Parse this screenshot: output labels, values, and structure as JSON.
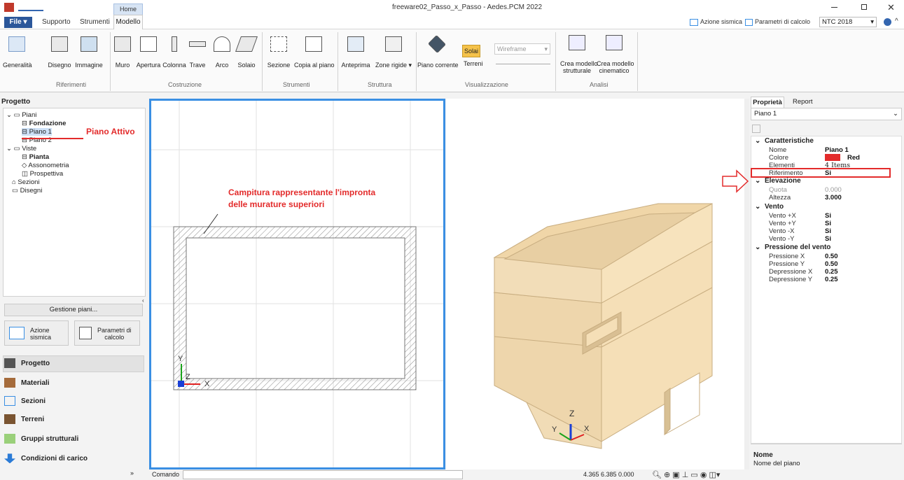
{
  "window": {
    "title": "freeware02_Passo_x_Passo - Aedes.PCM 2022",
    "quick_tab": "Home"
  },
  "tabs": {
    "file": "File",
    "supporto": "Supporto",
    "strumenti": "Strumenti",
    "modello": "Modello"
  },
  "topright": {
    "azione_sismica": "Azione sismica",
    "parametri": "Parametri di calcolo",
    "norm": "NTC 2018"
  },
  "ribbon": {
    "generalita": "Generalità",
    "disegno": "Disegno",
    "immagine": "Immagine",
    "riferimenti": "Riferimenti",
    "muro": "Muro",
    "apertura": "Apertura",
    "colonna": "Colonna",
    "trave": "Trave",
    "arco": "Arco",
    "solaio": "Solaio",
    "costruzione": "Costruzione",
    "sezione": "Sezione",
    "copia": "Copia al piano",
    "strumenti": "Strumenti",
    "anteprima": "Anteprima",
    "zone": "Zone rigide",
    "struttura": "Struttura",
    "piano_corrente": "Piano corrente",
    "solai": "Solai",
    "terreni": "Terreni",
    "wireframe": "Wireframe",
    "visualizzazione": "Visualizzazione",
    "crea_strutt_1": "Crea modello",
    "crea_strutt_2": "strutturale",
    "crea_cin_1": "Crea modello",
    "crea_cin_2": "cinematico",
    "analisi": "Analisi"
  },
  "left": {
    "header": "Progetto",
    "tree": {
      "piani": "Piani",
      "fondazione": "Fondazione",
      "piano1": "Piano 1",
      "piano2": "Piano 2",
      "viste": "Viste",
      "pianta": "Pianta",
      "assonometria": "Assonometria",
      "prospettiva": "Prospettiva",
      "sezioni": "Sezioni",
      "disegni": "Disegni"
    },
    "gestione": "Gestione piani...",
    "azione_1": "Azione",
    "azione_2": "sismica",
    "param_1": "Parametri di",
    "param_2": "calcolo",
    "nav": [
      "Progetto",
      "Materiali",
      "Sezioni",
      "Terreni",
      "Gruppi strutturali",
      "Condizioni di carico"
    ]
  },
  "annotations": {
    "piano_attivo": "Piano Attivo",
    "campitura_1": "Campitura rappresentante l'impronta",
    "campitura_2": "delle murature superiori"
  },
  "right": {
    "tab_proprieta": "Proprietà",
    "tab_report": "Report",
    "selector": "Piano 1",
    "groups": {
      "caratteristiche": "Caratteristiche",
      "elevazione": "Elevazione",
      "vento": "Vento",
      "pressione": "Pressione del vento"
    },
    "caratteristiche": [
      [
        "Nome",
        "Piano 1"
      ],
      [
        "Colore",
        "Red"
      ],
      [
        "Elementi",
        "4 Items"
      ],
      [
        "Riferimento",
        "Si"
      ]
    ],
    "elevazione": [
      [
        "Quota",
        "0.000"
      ],
      [
        "Altezza",
        "3.000"
      ]
    ],
    "vento": [
      [
        "Vento +X",
        "Si"
      ],
      [
        "Vento +Y",
        "Si"
      ],
      [
        "Vento -X",
        "Si"
      ],
      [
        "Vento -Y",
        "Si"
      ]
    ],
    "pressione": [
      [
        "Pressione X",
        "0.50"
      ],
      [
        "Pressione Y",
        "0.50"
      ],
      [
        "Depressione X",
        "0.25"
      ],
      [
        "Depressione Y",
        "0.25"
      ]
    ],
    "help_title": "Nome",
    "help_text": "Nome del piano"
  },
  "status": {
    "comando": "Comando",
    "coords": "4.365   6.385   0.000"
  },
  "colors": {
    "accent": "#3a8fe3",
    "annotation": "#e32b2b",
    "wall": "#f5dfb7"
  }
}
